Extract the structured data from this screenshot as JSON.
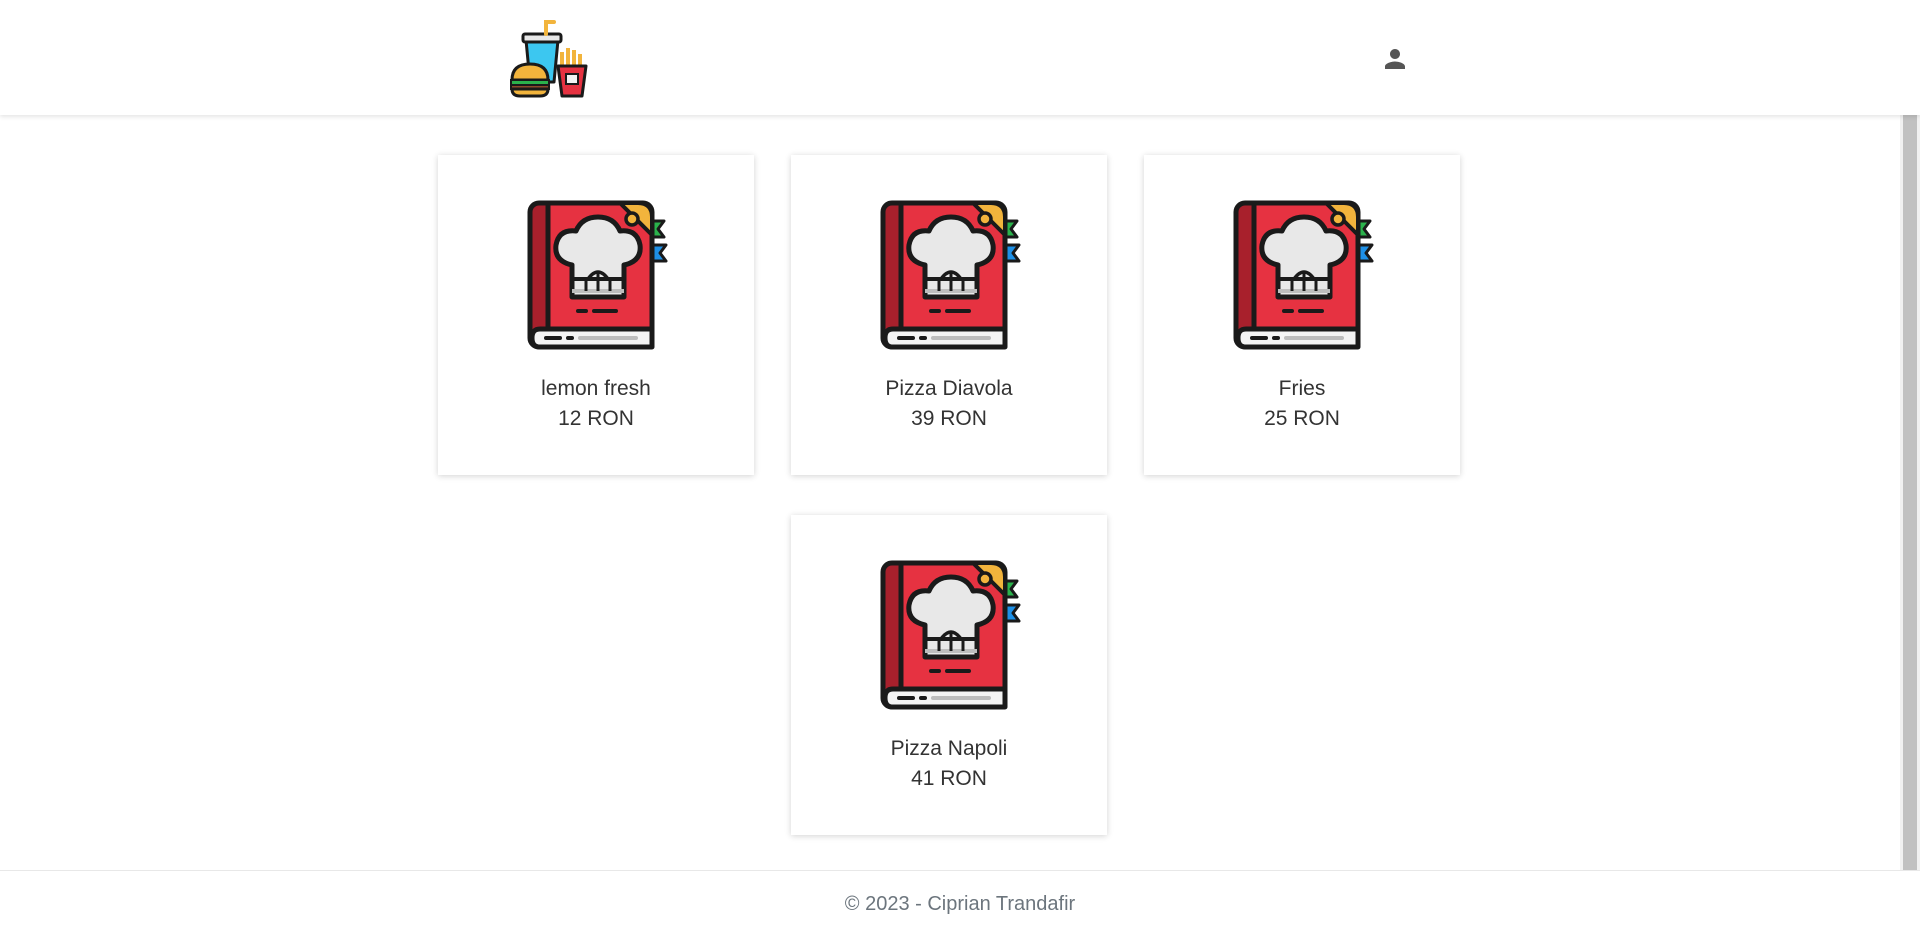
{
  "header": {
    "logo_icon": "fast-food-combo-icon",
    "account_icon": "person-icon"
  },
  "products": [
    {
      "name": "lemon fresh",
      "price": "12 RON",
      "icon": "recipe-book-icon"
    },
    {
      "name": "Pizza Diavola",
      "price": "39 RON",
      "icon": "recipe-book-icon"
    },
    {
      "name": "Fries",
      "price": "25 RON",
      "icon": "recipe-book-icon"
    },
    {
      "name": "Pizza Napoli",
      "price": "41 RON",
      "icon": "recipe-book-icon"
    }
  ],
  "footer": {
    "text": "© 2023 - Ciprian Trandafir"
  },
  "colors": {
    "book_red": "#e63241",
    "book_dark_red": "#a8202c",
    "outline": "#1a1a1a",
    "hat": "#e8e8e8",
    "corner": "#f2b43c",
    "ribbon_green": "#2bb24c",
    "ribbon_blue": "#1e90e6",
    "footer_text": "#6c757d"
  }
}
